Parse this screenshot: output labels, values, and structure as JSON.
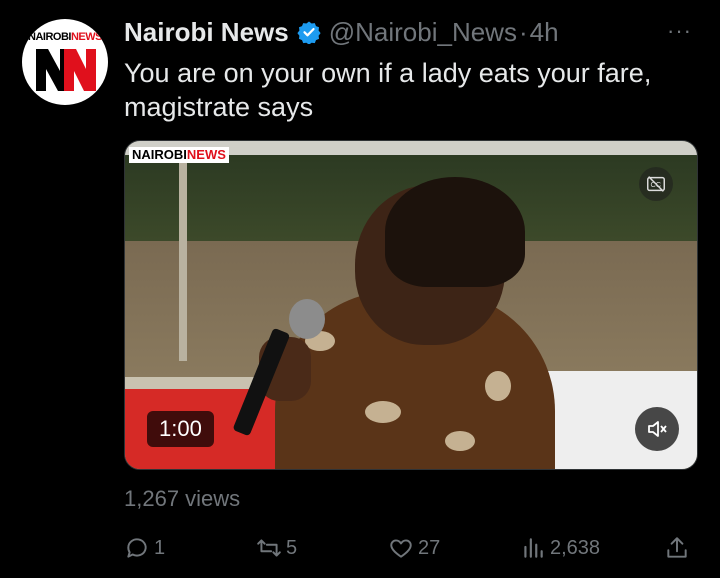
{
  "tweet": {
    "account_name": "Nairobi News",
    "handle": "@Nairobi_News",
    "separator": "·",
    "time_ago": "4h",
    "more_label": "···",
    "text": "You are on your own if a lady eats your fare, magistrate says",
    "avatar_logo": {
      "part1": "NAIROBI",
      "part2": "NEWS"
    },
    "verified_color": "#1d9bf0"
  },
  "media": {
    "watermark": {
      "part1": "NAIROBI",
      "part2": "NEWS"
    },
    "duration": "1:00",
    "cc_icon": "closed-captions-off-icon",
    "mute_icon": "speaker-muted-icon"
  },
  "stats": {
    "views": "1,267 views",
    "replies": "1",
    "reposts": "5",
    "likes": "27",
    "analytics": "2,638"
  }
}
